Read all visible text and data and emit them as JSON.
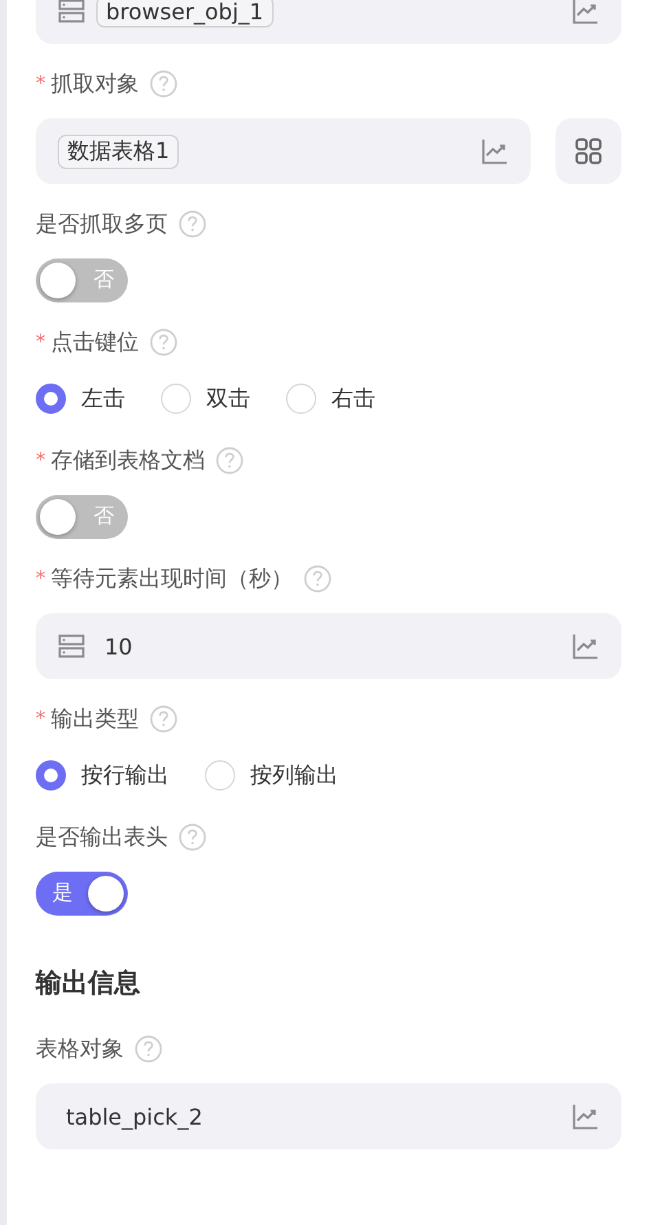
{
  "form": [
    {
      "kind": "input",
      "value": "browser_obj_1",
      "tagged": true,
      "source_icon": true,
      "side_button": false
    },
    {
      "kind": "input",
      "label": "抓取对象",
      "required_mark": "*",
      "value": "数据表格1",
      "tagged": true,
      "source_icon": false,
      "side_button": true
    },
    {
      "kind": "toggle",
      "label": "是否抓取多页",
      "on": false,
      "text": "否"
    },
    {
      "kind": "radio",
      "label": "点击键位",
      "required_mark": "*",
      "options": [
        {
          "label": "左击",
          "selected": true
        },
        {
          "label": "双击",
          "selected": false
        },
        {
          "label": "右击",
          "selected": false
        }
      ]
    },
    {
      "kind": "toggle",
      "label": "存储到表格文档",
      "required_mark": "*",
      "on": false,
      "text": "否"
    },
    {
      "kind": "input",
      "label": "等待元素出现时间（秒）",
      "required_mark": "*",
      "value": "10",
      "tagged": false,
      "source_icon": true,
      "side_button": false
    },
    {
      "kind": "radio",
      "label": "输出类型",
      "required_mark": "*",
      "options": [
        {
          "label": "按行输出",
          "selected": true
        },
        {
          "label": "按列输出",
          "selected": false
        }
      ]
    },
    {
      "kind": "toggle",
      "label": "是否输出表头",
      "on": true,
      "text": "是"
    },
    {
      "kind": "heading",
      "text": "输出信息"
    },
    {
      "kind": "input",
      "label": "表格对象",
      "value": "table_pick_2",
      "tagged": false,
      "source_icon": false,
      "side_button": false
    }
  ]
}
